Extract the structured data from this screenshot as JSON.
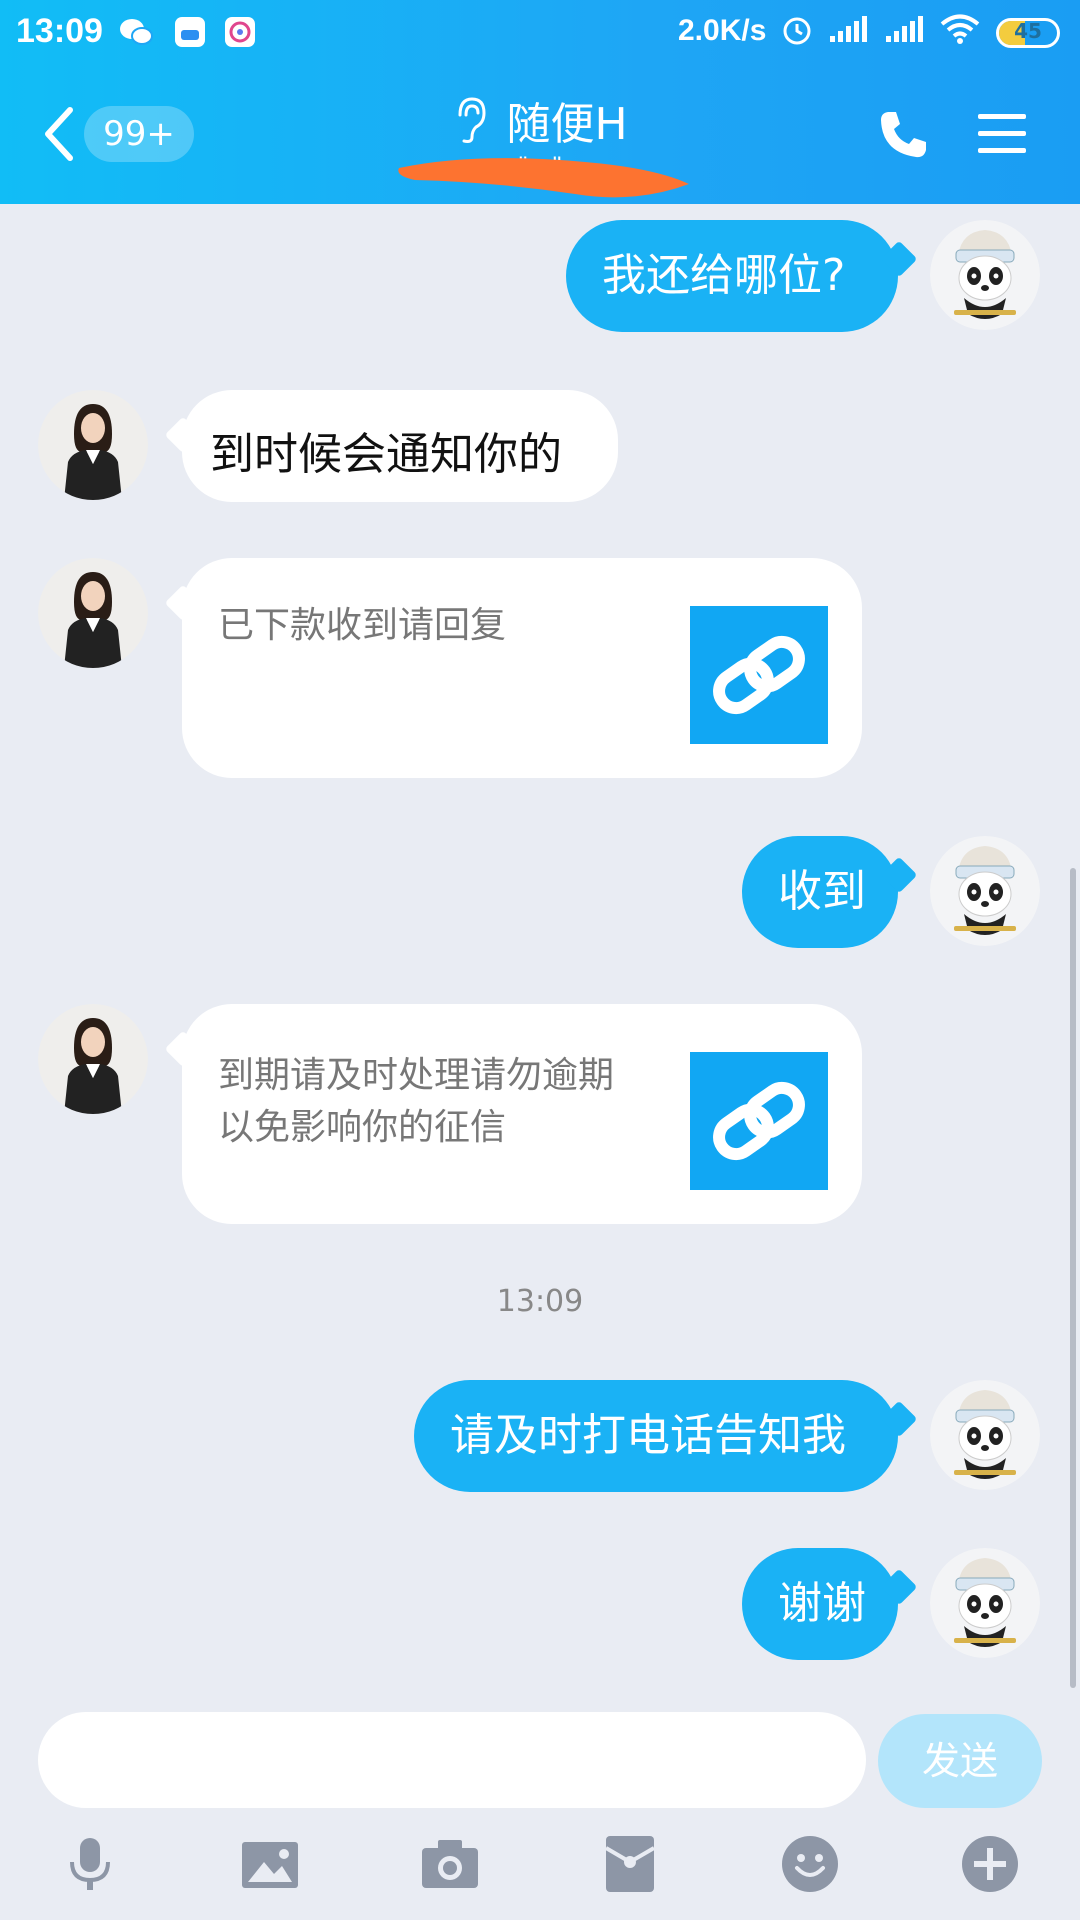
{
  "status_bar": {
    "time": "13:09",
    "network_speed": "2.0K/s",
    "battery_level": "45",
    "battery_fraction": 0.45,
    "icons": [
      "wechat-icon",
      "app-icon",
      "qq-icon",
      "alarm-icon",
      "signal-icon",
      "signal-icon",
      "wifi-icon",
      "battery-icon"
    ]
  },
  "header": {
    "unread_count": "99+",
    "title": "随便H",
    "subtitle": "\"...\"",
    "icons": [
      "chevron-left-icon",
      "ear-icon",
      "phone-icon",
      "menu-icon"
    ]
  },
  "messages": [
    {
      "side": "out",
      "text": "我还给哪位?"
    },
    {
      "side": "in",
      "text": "到时候会通知你的"
    },
    {
      "side": "in",
      "type": "link-card",
      "text": "已下款收到请回复"
    },
    {
      "side": "out",
      "text": "收到"
    },
    {
      "side": "in",
      "type": "link-card",
      "text": "到期请及时处理请勿逾期以免影响你的征信"
    },
    {
      "side": "out",
      "text": "请及时打电话告知我"
    },
    {
      "side": "out",
      "text": "谢谢"
    }
  ],
  "time_separator": "13:09",
  "composer": {
    "input_value": "",
    "send_label": "发送",
    "toolbar": [
      "microphone-icon",
      "image-icon",
      "camera-icon",
      "red-packet-icon",
      "emoji-icon",
      "plus-icon"
    ]
  },
  "colors": {
    "header": "#1ea6f5",
    "outgoing_bubble": "#1ab2f5",
    "incoming_bubble": "#ffffff",
    "background": "#e9ecf3",
    "send_button": "#b3e5fb"
  }
}
